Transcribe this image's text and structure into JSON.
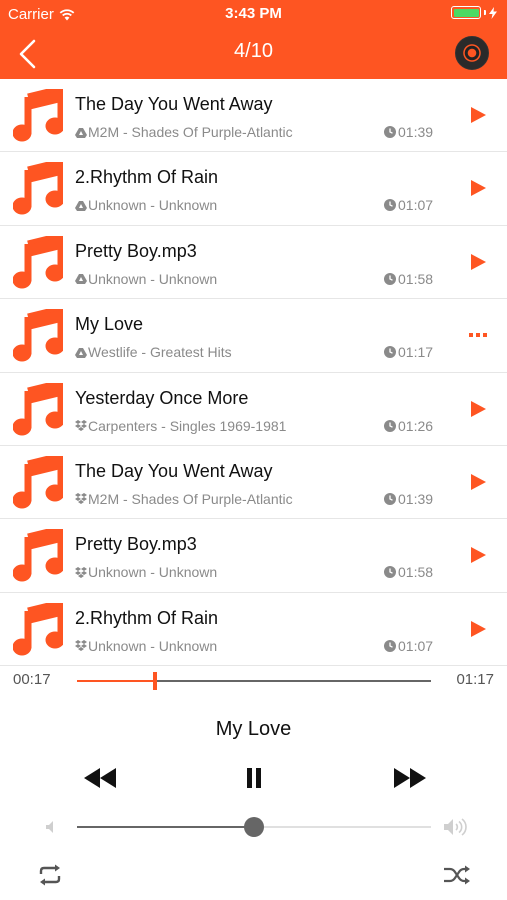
{
  "status_bar": {
    "carrier": "Carrier",
    "time": "3:43 PM"
  },
  "nav": {
    "title": "4/10",
    "back_icon": "chevron-left-icon",
    "disc_icon": "vinyl-disc-icon"
  },
  "colors": {
    "accent": "#fe5522",
    "battery": "#4cd964",
    "text_secondary": "#8a8a8a"
  },
  "songs": [
    {
      "title": "The Day You Went Away",
      "subtitle": "M2M - Shades Of Purple-Atlantic",
      "duration": "01:39",
      "source": "cloud",
      "state": "play"
    },
    {
      "title": "2.Rhythm Of Rain",
      "subtitle": "Unknown - Unknown",
      "duration": "01:07",
      "source": "cloud",
      "state": "play"
    },
    {
      "title": "Pretty Boy.mp3",
      "subtitle": "Unknown - Unknown",
      "duration": "01:58",
      "source": "cloud",
      "state": "play"
    },
    {
      "title": "My Love",
      "subtitle": "Westlife - Greatest Hits",
      "duration": "01:17",
      "source": "cloud",
      "state": "playing"
    },
    {
      "title": "Yesterday Once More",
      "subtitle": "Carpenters - Singles 1969-1981",
      "duration": "01:26",
      "source": "dropbox",
      "state": "play"
    },
    {
      "title": "The Day You Went Away",
      "subtitle": "M2M - Shades Of Purple-Atlantic",
      "duration": "01:39",
      "source": "dropbox",
      "state": "play"
    },
    {
      "title": "Pretty Boy.mp3",
      "subtitle": "Unknown - Unknown",
      "duration": "01:58",
      "source": "dropbox",
      "state": "play"
    },
    {
      "title": "2.Rhythm Of Rain",
      "subtitle": "Unknown - Unknown",
      "duration": "01:07",
      "source": "dropbox",
      "state": "play"
    }
  ],
  "player": {
    "current_time": "00:17",
    "total_time": "01:17",
    "progress": 0.22,
    "now_playing": "My Love",
    "volume": 0.5
  }
}
